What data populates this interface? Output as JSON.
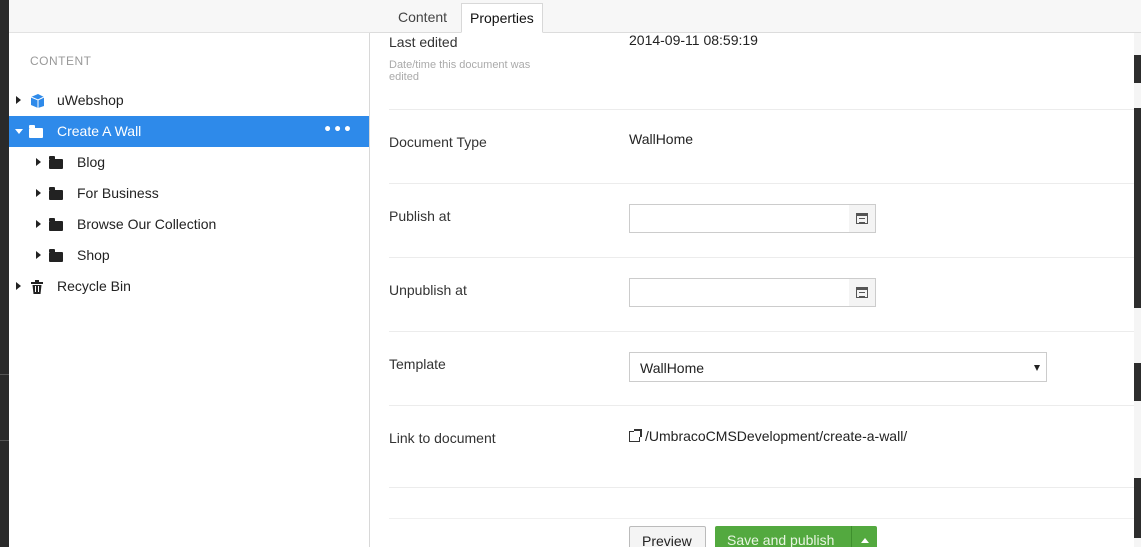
{
  "tree": {
    "heading": "CONTENT",
    "nodes": [
      {
        "label": "uWebshop",
        "icon": "box-icon",
        "active": false
      },
      {
        "label": "Create A Wall",
        "icon": "folder-icon",
        "active": true
      },
      {
        "label": "Blog",
        "icon": "folder-icon",
        "active": false
      },
      {
        "label": "For Business",
        "icon": "folder-icon",
        "active": false
      },
      {
        "label": "Browse Our Collection",
        "icon": "folder-icon",
        "active": false
      },
      {
        "label": "Shop",
        "icon": "folder-icon",
        "active": false
      },
      {
        "label": "Recycle Bin",
        "icon": "trash-icon",
        "active": false
      }
    ],
    "more_label": "•••"
  },
  "tabs": {
    "content": "Content",
    "properties": "Properties"
  },
  "properties": {
    "last_edited": {
      "label": "Last edited",
      "description": "Date/time this document was edited",
      "value": "2014-09-11 08:59:19"
    },
    "document_type": {
      "label": "Document Type",
      "value": "WallHome"
    },
    "publish_at": {
      "label": "Publish at",
      "value": ""
    },
    "unpublish_at": {
      "label": "Unpublish at",
      "value": ""
    },
    "template": {
      "label": "Template",
      "value": "WallHome"
    },
    "link": {
      "label": "Link to document",
      "value": "/UmbracoCMSDevelopment/create-a-wall/"
    }
  },
  "buttons": {
    "preview": "Preview",
    "save_publish": "Save and publish"
  },
  "colors": {
    "active_node": "#2e8aea",
    "save_button": "#53a93f"
  }
}
